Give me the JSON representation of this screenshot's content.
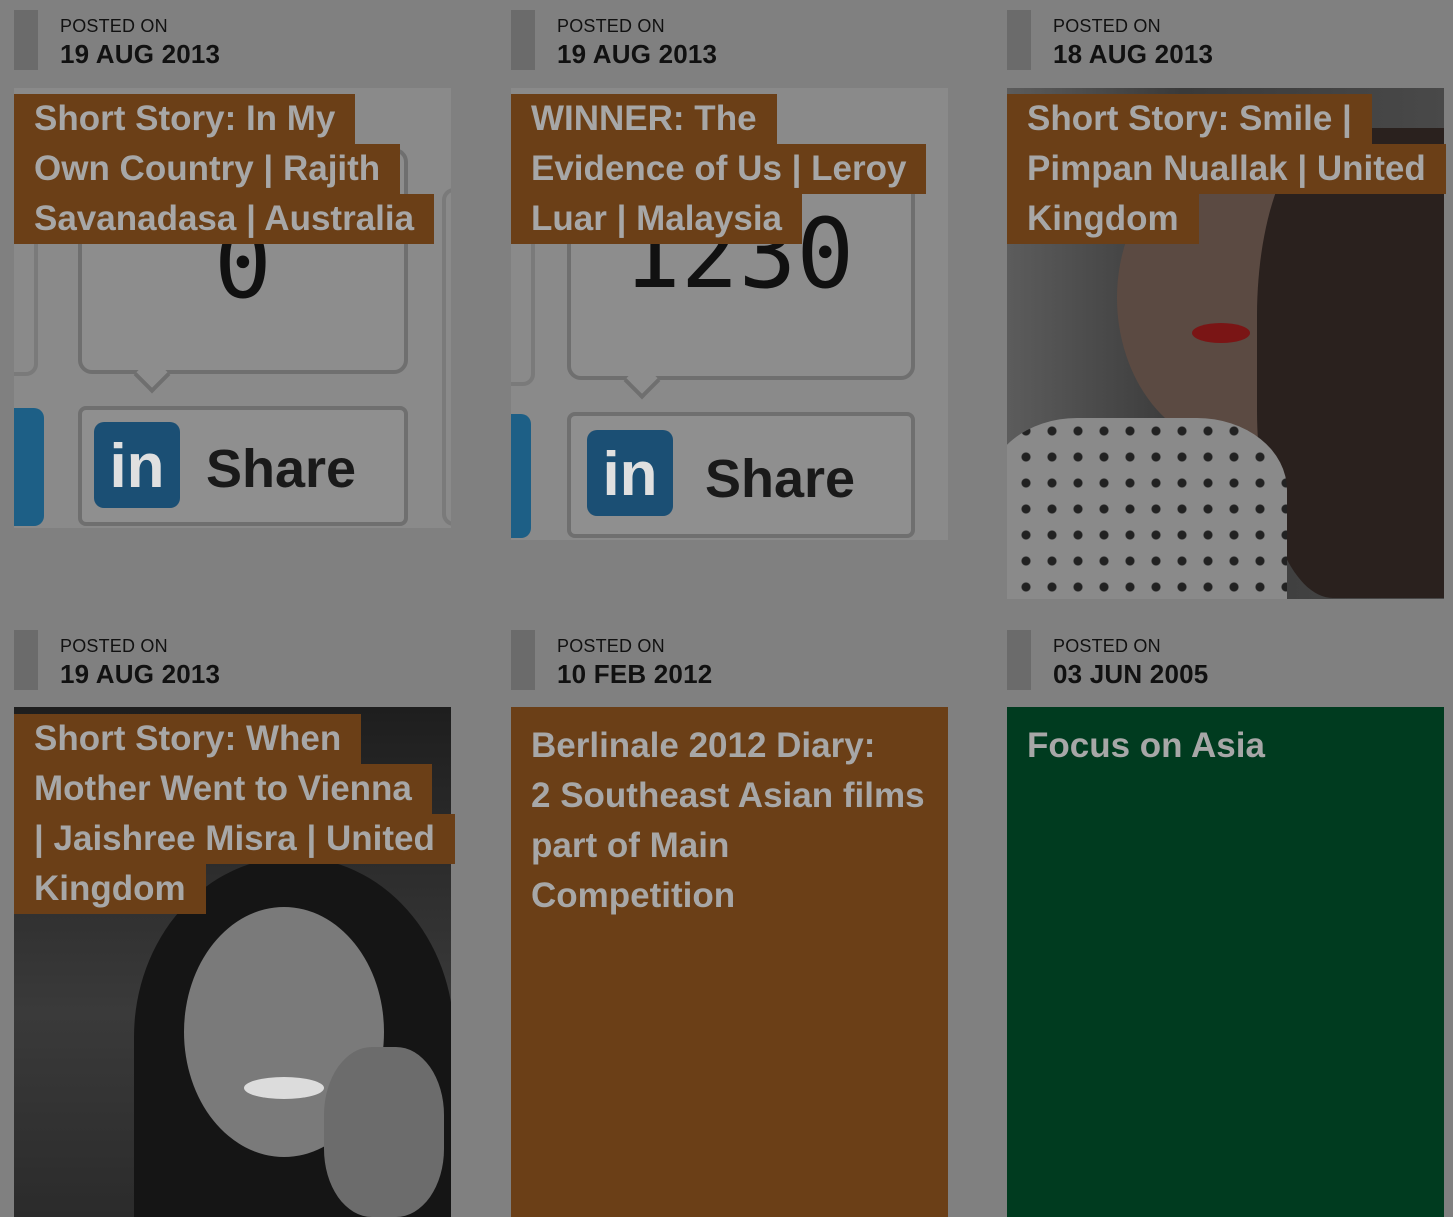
{
  "posts": [
    {
      "posted_label": "POSTED ON",
      "date": "19 AUG 2013",
      "title_lines": [
        "Short Story: In My",
        "Own Country | Rajith",
        "Savanadasa | Australia"
      ],
      "media": "linkedin-share-image",
      "share": {
        "count": "0",
        "button": "Share",
        "logo": "in"
      }
    },
    {
      "posted_label": "POSTED ON",
      "date": "19 AUG 2013",
      "title_lines": [
        "WINNER: The",
        "Evidence of Us | Leroy",
        "Luar | Malaysia"
      ],
      "media": "linkedin-share-image",
      "share": {
        "count": "1230",
        "button": "Share",
        "logo": "in"
      }
    },
    {
      "posted_label": "POSTED ON",
      "date": "18 AUG 2013",
      "title_lines": [
        "Short Story: Smile |",
        "Pimpan Nuallak | United",
        "Kingdom"
      ],
      "media": "portrait-photo"
    },
    {
      "posted_label": "POSTED ON",
      "date": "19 AUG 2013",
      "title_lines": [
        "Short Story: When",
        "Mother Went to Vienna",
        "| Jaishree Misra | United",
        "Kingdom"
      ],
      "media": "portrait-photo"
    },
    {
      "posted_label": "POSTED ON",
      "date": "10 FEB 2012",
      "title_lines": [
        "Berlinale 2012 Diary:",
        "2 Southeast Asian films",
        "part of Main",
        "Competition"
      ],
      "media": "color-block",
      "color": "#6b3f17"
    },
    {
      "posted_label": "POSTED ON",
      "date": "03 JUN 2005",
      "title_lines": [
        "Focus on Asia"
      ],
      "media": "color-block",
      "color": "#003b1f"
    }
  ],
  "colors": {
    "overlay_gray": "#808080",
    "title_bg": "#6b3f17",
    "green_block": "#003b1f"
  }
}
